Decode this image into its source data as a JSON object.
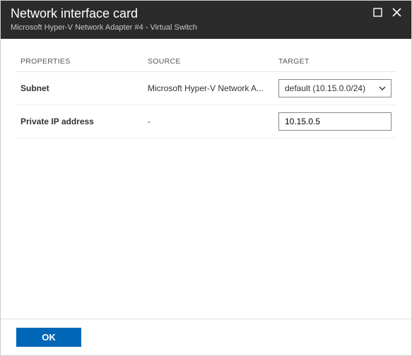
{
  "titlebar": {
    "title": "Network interface card",
    "subtitle": "Microsoft Hyper-V Network Adapter #4 - Virtual Switch"
  },
  "table": {
    "headers": {
      "properties": "PROPERTIES",
      "source": "SOURCE",
      "target": "TARGET"
    },
    "rows": {
      "subnet": {
        "label": "Subnet",
        "source": "Microsoft Hyper-V Network A...",
        "target_selected": "default (10.15.0.0/24)"
      },
      "private_ip": {
        "label": "Private IP address",
        "source": "-",
        "target_value": "10.15.0.5"
      }
    }
  },
  "footer": {
    "ok": "OK"
  }
}
